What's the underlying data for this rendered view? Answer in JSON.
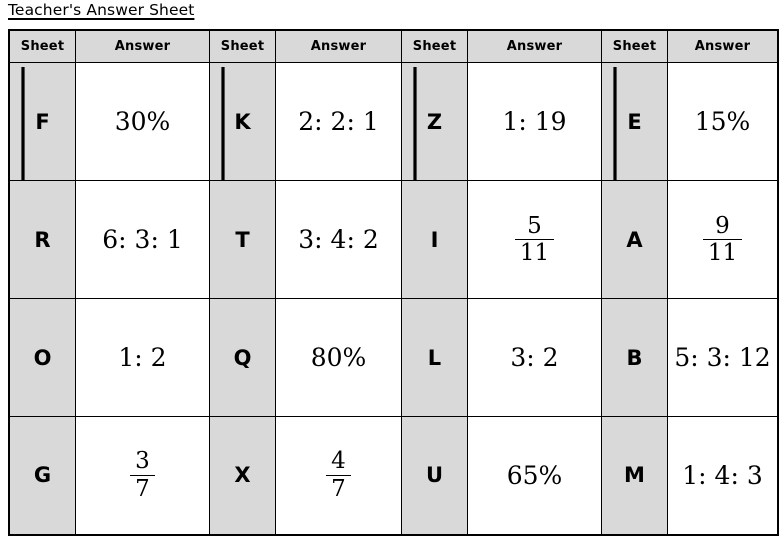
{
  "document": {
    "title": "Teacher's Answer Sheet"
  },
  "table": {
    "headers": [
      "Sheet",
      "Answer",
      "Sheet",
      "Answer",
      "Sheet",
      "Answer",
      "Sheet",
      "Answer"
    ],
    "colors": {
      "sheet_cell_bg": "#d9d9d9",
      "answer_cell_bg": "#ffffff",
      "border": "#000000",
      "text": "#000000"
    },
    "rows": [
      {
        "pairs": [
          {
            "sheet": "F",
            "answer": {
              "kind": "plain",
              "text": "30%"
            }
          },
          {
            "sheet": "K",
            "answer": {
              "kind": "plain",
              "text": "2: 2: 1"
            }
          },
          {
            "sheet": "Z",
            "answer": {
              "kind": "plain",
              "text": "1: 19"
            }
          },
          {
            "sheet": "E",
            "answer": {
              "kind": "plain",
              "text": "15%"
            }
          }
        ]
      },
      {
        "pairs": [
          {
            "sheet": "R",
            "answer": {
              "kind": "plain",
              "text": "6: 3: 1"
            }
          },
          {
            "sheet": "T",
            "answer": {
              "kind": "plain",
              "text": "3: 4: 2"
            }
          },
          {
            "sheet": "I",
            "answer": {
              "kind": "fraction",
              "numerator": "5",
              "denominator": "11"
            }
          },
          {
            "sheet": "A",
            "answer": {
              "kind": "fraction",
              "numerator": "9",
              "denominator": "11"
            }
          }
        ]
      },
      {
        "pairs": [
          {
            "sheet": "O",
            "answer": {
              "kind": "plain",
              "text": "1: 2"
            }
          },
          {
            "sheet": "Q",
            "answer": {
              "kind": "plain",
              "text": "80%"
            }
          },
          {
            "sheet": "L",
            "answer": {
              "kind": "plain",
              "text": "3: 2"
            }
          },
          {
            "sheet": "B",
            "answer": {
              "kind": "plain",
              "text": "5: 3: 12"
            }
          }
        ]
      },
      {
        "pairs": [
          {
            "sheet": "G",
            "answer": {
              "kind": "fraction",
              "numerator": "3",
              "denominator": "7"
            }
          },
          {
            "sheet": "X",
            "answer": {
              "kind": "fraction",
              "numerator": "4",
              "denominator": "7"
            }
          },
          {
            "sheet": "U",
            "answer": {
              "kind": "plain",
              "text": "65%"
            }
          },
          {
            "sheet": "M",
            "answer": {
              "kind": "plain",
              "text": "1: 4: 3"
            }
          }
        ]
      }
    ],
    "annotations": {
      "arrow_count": 4,
      "arrow_direction": "down",
      "arrow_description": "down-arrow spanning first sheet row into second sheet row",
      "arrow_columns": [
        "F",
        "K",
        "Z",
        "E"
      ]
    }
  }
}
